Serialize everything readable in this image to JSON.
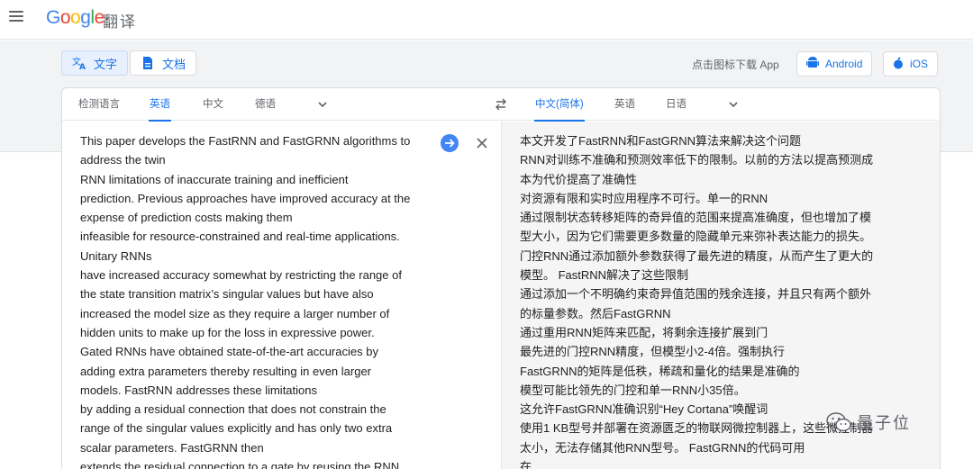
{
  "header": {
    "logo_text": "Google",
    "app_name": "翻译"
  },
  "modes": [
    {
      "label": "文字",
      "icon": "translate-icon",
      "active": true
    },
    {
      "label": "文档",
      "icon": "document-icon",
      "active": false
    }
  ],
  "download": {
    "text": "点击图标下载 App",
    "android_label": "Android",
    "ios_label": "iOS"
  },
  "source_langs": [
    "检测语言",
    "英语",
    "中文",
    "德语"
  ],
  "target_langs": [
    "中文(简体)",
    "英语",
    "日语"
  ],
  "source_lines": [
    "This paper develops the FastRNN and FastGRNN algorithms to",
    "address the twin",
    "RNN limitations of inaccurate training and inefficient",
    "prediction. Previous approaches have improved accuracy at the",
    "expense of prediction costs making them",
    "infeasible for resource-constrained and real-time applications.",
    "Unitary RNNs",
    "have increased accuracy somewhat by restricting the range of",
    "the state transition matrix’s singular values but have also",
    "increased the model size as they require a larger number of",
    "hidden units to make up for the loss in expressive power.",
    "Gated RNNs have obtained state-of-the-art accuracies by",
    "adding extra parameters thereby resulting in even larger",
    "models. FastRNN addresses these limitations",
    "by adding a residual connection that does not constrain the",
    "range of the singular values explicitly and has only two extra",
    "scalar parameters. FastGRNN then",
    "extends the residual connection to a gate by reusing the RNN"
  ],
  "target_lines": [
    "本文开发了FastRNN和FastGRNN算法来解决这个问题",
    "RNN对训练不准确和预测效率低下的限制。以前的方法以提高预测成",
    "本为代价提高了准确性",
    "对资源有限和实时应用程序不可行。单一的RNN",
    "通过限制状态转移矩阵的奇异值的范围来提高准确度，但也增加了模",
    "型大小，因为它们需要更多数量的隐藏单元来弥补表达能力的损失。",
    "门控RNN通过添加额外参数获得了最先进的精度，从而产生了更大的",
    "模型。 FastRNN解决了这些限制",
    "通过添加一个不明确约束奇异值范围的残余连接，并且只有两个额外",
    "的标量参数。然后FastGRNN",
    "通过重用RNN矩阵来匹配，将剩余连接扩展到门",
    "最先进的门控RNN精度，但模型小2-4倍。强制执行",
    "FastGRNN的矩阵是低秩，稀疏和量化的结果是准确的",
    "模型可能比领先的门控和单一RNN小35倍。",
    "这允许FastGRNN准确识别“Hey Cortana”唤醒词",
    "使用1 KB型号并部署在资源匮乏的物联网微控制器上，这些微控制器",
    "太小，无法存储其他RNN型号。 FastGRNN的代码可用",
    "在"
  ],
  "watermark": "量子位",
  "colors": {
    "accent": "#1a73e8",
    "google_blue": "#4285f4",
    "google_red": "#ea4335",
    "google_yellow": "#fbbc05",
    "google_green": "#34a853",
    "android_green": "#3ddc84"
  }
}
